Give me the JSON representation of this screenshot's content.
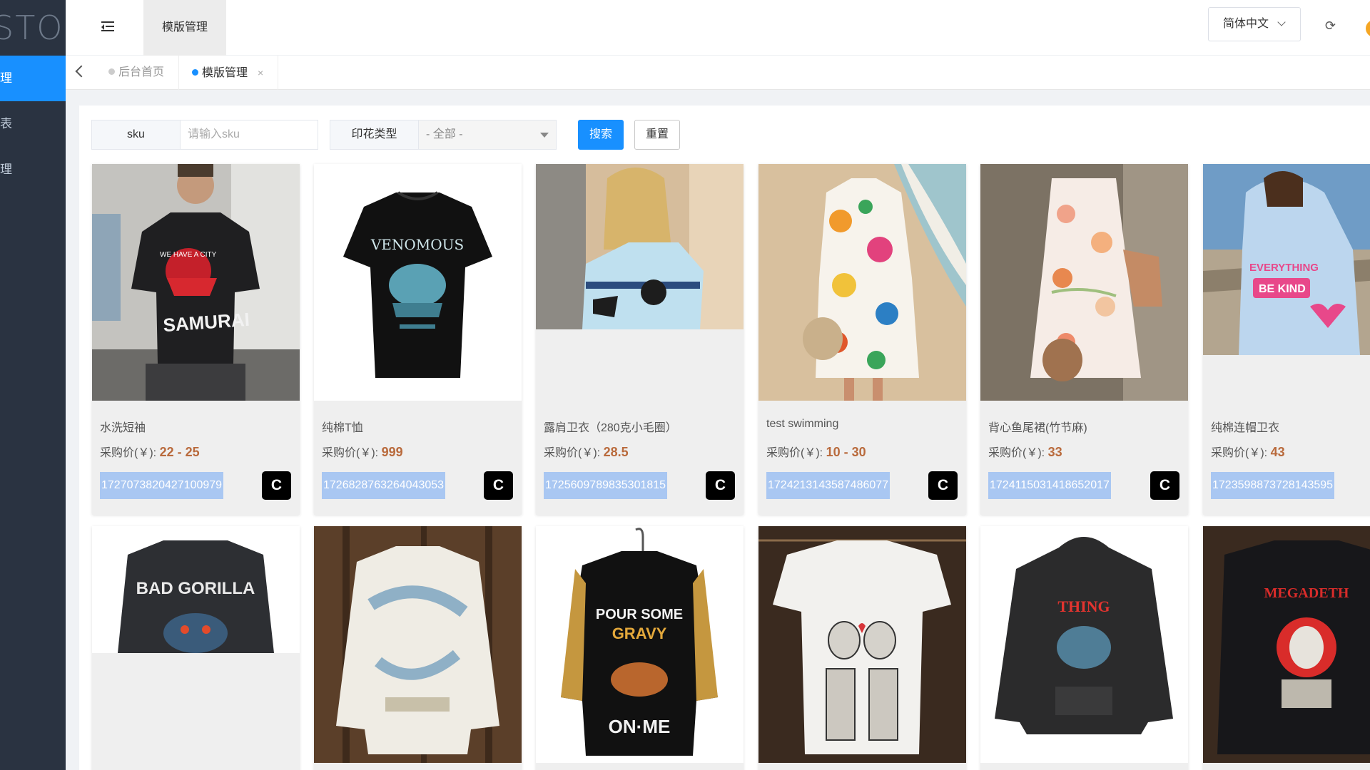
{
  "sidebar": {
    "logo_text": "STOM",
    "items": [
      {
        "label": "理"
      },
      {
        "label": "表"
      },
      {
        "label": "理"
      }
    ]
  },
  "header": {
    "active_tab": "模版管理",
    "language": "简体中文"
  },
  "tags": [
    {
      "label": "后台首页"
    },
    {
      "label": "模版管理",
      "close": "×"
    }
  ],
  "filters": {
    "sku_label": "sku",
    "sku_placeholder": "请输入sku",
    "print_type_label": "印花类型",
    "print_type_value": "- 全部 -",
    "search_button": "搜索",
    "reset_button": "重置"
  },
  "price_prefix": "采购价(￥): ",
  "products": [
    {
      "name": "水洗短袖",
      "price": "22 - 25",
      "sku": "1727073820427100979",
      "badge": "C",
      "image": "man in black samurai tee"
    },
    {
      "name": "纯棉T恤",
      "price": "999",
      "sku": "1726828763264043053",
      "badge": "C",
      "image": "black venomous tee"
    },
    {
      "name": "露肩卫衣（280克小毛圈）",
      "price": "28.5",
      "sku": "1725609789835301815",
      "badge": "C",
      "image": "off-shoulder sweatshirt"
    },
    {
      "name": "test swimming",
      "price": "10 - 30",
      "sku": "1724213143587486077",
      "badge": "C",
      "image": "floral dress on beach"
    },
    {
      "name": "背心鱼尾裙(竹节麻)",
      "price": "33",
      "sku": "1724115031418652017",
      "badge": "C",
      "image": "floral sleeveless dress"
    },
    {
      "name": "纯棉连帽卫衣",
      "price": "43",
      "sku": "1723598873728143595",
      "badge": "C",
      "image": "blue hoodie be kind"
    }
  ],
  "products_row2": [
    {
      "image": "bad gorilla denim jacket"
    },
    {
      "image": "abstract print sweater"
    },
    {
      "image": "pour some gravy on me shirt"
    },
    {
      "image": "skeleton couple tee"
    },
    {
      "image": "the thing hoodie"
    },
    {
      "image": "megadeth sweatshirt"
    }
  ],
  "colors": {
    "sidebar_bg": "#2a3341",
    "accent": "#1890ff",
    "price": "#b96a3c",
    "sku_bg": "#a9c7f2"
  }
}
